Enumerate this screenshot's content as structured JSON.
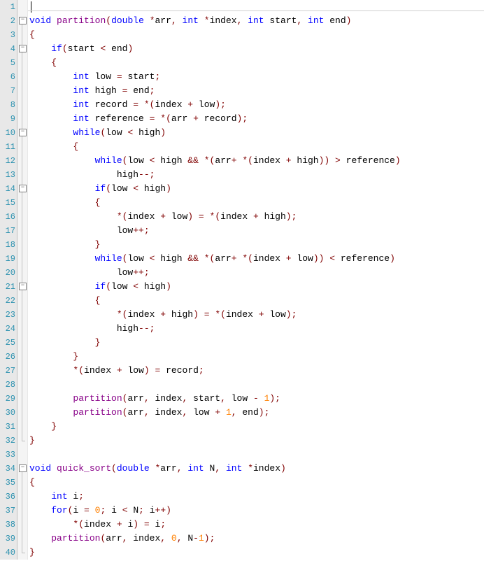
{
  "line_count": 40,
  "fold_boxes": [
    {
      "line": 2
    },
    {
      "line": 4
    },
    {
      "line": 10
    },
    {
      "line": 14
    },
    {
      "line": 21
    },
    {
      "line": 34
    }
  ],
  "fold_ends": [
    {
      "line": 32
    },
    {
      "line": 40
    }
  ],
  "code_lines": [
    [],
    [
      [
        "kw",
        "void"
      ],
      [
        "plain",
        " "
      ],
      [
        "fn",
        "partition"
      ],
      [
        "op",
        "("
      ],
      [
        "kw",
        "double"
      ],
      [
        "plain",
        " "
      ],
      [
        "op",
        "*"
      ],
      [
        "plain",
        "arr"
      ],
      [
        "op",
        ","
      ],
      [
        "plain",
        " "
      ],
      [
        "kw",
        "int"
      ],
      [
        "plain",
        " "
      ],
      [
        "op",
        "*"
      ],
      [
        "plain",
        "index"
      ],
      [
        "op",
        ","
      ],
      [
        "plain",
        " "
      ],
      [
        "kw",
        "int"
      ],
      [
        "plain",
        " start"
      ],
      [
        "op",
        ","
      ],
      [
        "plain",
        " "
      ],
      [
        "kw",
        "int"
      ],
      [
        "plain",
        " end"
      ],
      [
        "op",
        ")"
      ]
    ],
    [
      [
        "op",
        "{"
      ]
    ],
    [
      [
        "plain",
        "    "
      ],
      [
        "kw",
        "if"
      ],
      [
        "op",
        "("
      ],
      [
        "plain",
        "start "
      ],
      [
        "op",
        "<"
      ],
      [
        "plain",
        " end"
      ],
      [
        "op",
        ")"
      ]
    ],
    [
      [
        "plain",
        "    "
      ],
      [
        "op",
        "{"
      ]
    ],
    [
      [
        "plain",
        "        "
      ],
      [
        "kw",
        "int"
      ],
      [
        "plain",
        " low "
      ],
      [
        "op",
        "="
      ],
      [
        "plain",
        " start"
      ],
      [
        "op",
        ";"
      ]
    ],
    [
      [
        "plain",
        "        "
      ],
      [
        "kw",
        "int"
      ],
      [
        "plain",
        " high "
      ],
      [
        "op",
        "="
      ],
      [
        "plain",
        " end"
      ],
      [
        "op",
        ";"
      ]
    ],
    [
      [
        "plain",
        "        "
      ],
      [
        "kw",
        "int"
      ],
      [
        "plain",
        " record "
      ],
      [
        "op",
        "="
      ],
      [
        "plain",
        " "
      ],
      [
        "op",
        "*("
      ],
      [
        "plain",
        "index "
      ],
      [
        "op",
        "+"
      ],
      [
        "plain",
        " low"
      ],
      [
        "op",
        ");"
      ]
    ],
    [
      [
        "plain",
        "        "
      ],
      [
        "kw",
        "int"
      ],
      [
        "plain",
        " reference "
      ],
      [
        "op",
        "="
      ],
      [
        "plain",
        " "
      ],
      [
        "op",
        "*("
      ],
      [
        "plain",
        "arr "
      ],
      [
        "op",
        "+"
      ],
      [
        "plain",
        " record"
      ],
      [
        "op",
        ");"
      ]
    ],
    [
      [
        "plain",
        "        "
      ],
      [
        "kw",
        "while"
      ],
      [
        "op",
        "("
      ],
      [
        "plain",
        "low "
      ],
      [
        "op",
        "<"
      ],
      [
        "plain",
        " high"
      ],
      [
        "op",
        ")"
      ]
    ],
    [
      [
        "plain",
        "        "
      ],
      [
        "op",
        "{"
      ]
    ],
    [
      [
        "plain",
        "            "
      ],
      [
        "kw",
        "while"
      ],
      [
        "op",
        "("
      ],
      [
        "plain",
        "low "
      ],
      [
        "op",
        "<"
      ],
      [
        "plain",
        " high "
      ],
      [
        "op",
        "&&"
      ],
      [
        "plain",
        " "
      ],
      [
        "op",
        "*("
      ],
      [
        "plain",
        "arr"
      ],
      [
        "op",
        "+"
      ],
      [
        "plain",
        " "
      ],
      [
        "op",
        "*("
      ],
      [
        "plain",
        "index "
      ],
      [
        "op",
        "+"
      ],
      [
        "plain",
        " high"
      ],
      [
        "op",
        "))"
      ],
      [
        "plain",
        " "
      ],
      [
        "op",
        ">"
      ],
      [
        "plain",
        " reference"
      ],
      [
        "op",
        ")"
      ]
    ],
    [
      [
        "plain",
        "                high"
      ],
      [
        "op",
        "--;"
      ]
    ],
    [
      [
        "plain",
        "            "
      ],
      [
        "kw",
        "if"
      ],
      [
        "op",
        "("
      ],
      [
        "plain",
        "low "
      ],
      [
        "op",
        "<"
      ],
      [
        "plain",
        " high"
      ],
      [
        "op",
        ")"
      ]
    ],
    [
      [
        "plain",
        "            "
      ],
      [
        "op",
        "{"
      ]
    ],
    [
      [
        "plain",
        "                "
      ],
      [
        "op",
        "*("
      ],
      [
        "plain",
        "index "
      ],
      [
        "op",
        "+"
      ],
      [
        "plain",
        " low"
      ],
      [
        "op",
        ")"
      ],
      [
        "plain",
        " "
      ],
      [
        "op",
        "="
      ],
      [
        "plain",
        " "
      ],
      [
        "op",
        "*("
      ],
      [
        "plain",
        "index "
      ],
      [
        "op",
        "+"
      ],
      [
        "plain",
        " high"
      ],
      [
        "op",
        ");"
      ]
    ],
    [
      [
        "plain",
        "                low"
      ],
      [
        "op",
        "++;"
      ]
    ],
    [
      [
        "plain",
        "            "
      ],
      [
        "op",
        "}"
      ]
    ],
    [
      [
        "plain",
        "            "
      ],
      [
        "kw",
        "while"
      ],
      [
        "op",
        "("
      ],
      [
        "plain",
        "low "
      ],
      [
        "op",
        "<"
      ],
      [
        "plain",
        " high "
      ],
      [
        "op",
        "&&"
      ],
      [
        "plain",
        " "
      ],
      [
        "op",
        "*("
      ],
      [
        "plain",
        "arr"
      ],
      [
        "op",
        "+"
      ],
      [
        "plain",
        " "
      ],
      [
        "op",
        "*("
      ],
      [
        "plain",
        "index "
      ],
      [
        "op",
        "+"
      ],
      [
        "plain",
        " low"
      ],
      [
        "op",
        "))"
      ],
      [
        "plain",
        " "
      ],
      [
        "op",
        "<"
      ],
      [
        "plain",
        " reference"
      ],
      [
        "op",
        ")"
      ]
    ],
    [
      [
        "plain",
        "                low"
      ],
      [
        "op",
        "++;"
      ]
    ],
    [
      [
        "plain",
        "            "
      ],
      [
        "kw",
        "if"
      ],
      [
        "op",
        "("
      ],
      [
        "plain",
        "low "
      ],
      [
        "op",
        "<"
      ],
      [
        "plain",
        " high"
      ],
      [
        "op",
        ")"
      ]
    ],
    [
      [
        "plain",
        "            "
      ],
      [
        "op",
        "{"
      ]
    ],
    [
      [
        "plain",
        "                "
      ],
      [
        "op",
        "*("
      ],
      [
        "plain",
        "index "
      ],
      [
        "op",
        "+"
      ],
      [
        "plain",
        " high"
      ],
      [
        "op",
        ")"
      ],
      [
        "plain",
        " "
      ],
      [
        "op",
        "="
      ],
      [
        "plain",
        " "
      ],
      [
        "op",
        "*("
      ],
      [
        "plain",
        "index "
      ],
      [
        "op",
        "+"
      ],
      [
        "plain",
        " low"
      ],
      [
        "op",
        ");"
      ]
    ],
    [
      [
        "plain",
        "                high"
      ],
      [
        "op",
        "--;"
      ]
    ],
    [
      [
        "plain",
        "            "
      ],
      [
        "op",
        "}"
      ]
    ],
    [
      [
        "plain",
        "        "
      ],
      [
        "op",
        "}"
      ]
    ],
    [
      [
        "plain",
        "        "
      ],
      [
        "op",
        "*("
      ],
      [
        "plain",
        "index "
      ],
      [
        "op",
        "+"
      ],
      [
        "plain",
        " low"
      ],
      [
        "op",
        ")"
      ],
      [
        "plain",
        " "
      ],
      [
        "op",
        "="
      ],
      [
        "plain",
        " record"
      ],
      [
        "op",
        ";"
      ]
    ],
    [],
    [
      [
        "plain",
        "        "
      ],
      [
        "fn",
        "partition"
      ],
      [
        "op",
        "("
      ],
      [
        "plain",
        "arr"
      ],
      [
        "op",
        ","
      ],
      [
        "plain",
        " index"
      ],
      [
        "op",
        ","
      ],
      [
        "plain",
        " start"
      ],
      [
        "op",
        ","
      ],
      [
        "plain",
        " low "
      ],
      [
        "op",
        "-"
      ],
      [
        "plain",
        " "
      ],
      [
        "num",
        "1"
      ],
      [
        "op",
        ");"
      ]
    ],
    [
      [
        "plain",
        "        "
      ],
      [
        "fn",
        "partition"
      ],
      [
        "op",
        "("
      ],
      [
        "plain",
        "arr"
      ],
      [
        "op",
        ","
      ],
      [
        "plain",
        " index"
      ],
      [
        "op",
        ","
      ],
      [
        "plain",
        " low "
      ],
      [
        "op",
        "+"
      ],
      [
        "plain",
        " "
      ],
      [
        "num",
        "1"
      ],
      [
        "op",
        ","
      ],
      [
        "plain",
        " end"
      ],
      [
        "op",
        ");"
      ]
    ],
    [
      [
        "plain",
        "    "
      ],
      [
        "op",
        "}"
      ]
    ],
    [
      [
        "op",
        "}"
      ]
    ],
    [],
    [
      [
        "kw",
        "void"
      ],
      [
        "plain",
        " "
      ],
      [
        "fn",
        "quick_sort"
      ],
      [
        "op",
        "("
      ],
      [
        "kw",
        "double"
      ],
      [
        "plain",
        " "
      ],
      [
        "op",
        "*"
      ],
      [
        "plain",
        "arr"
      ],
      [
        "op",
        ","
      ],
      [
        "plain",
        " "
      ],
      [
        "kw",
        "int"
      ],
      [
        "plain",
        " N"
      ],
      [
        "op",
        ","
      ],
      [
        "plain",
        " "
      ],
      [
        "kw",
        "int"
      ],
      [
        "plain",
        " "
      ],
      [
        "op",
        "*"
      ],
      [
        "plain",
        "index"
      ],
      [
        "op",
        ")"
      ]
    ],
    [
      [
        "op",
        "{"
      ]
    ],
    [
      [
        "plain",
        "    "
      ],
      [
        "kw",
        "int"
      ],
      [
        "plain",
        " i"
      ],
      [
        "op",
        ";"
      ]
    ],
    [
      [
        "plain",
        "    "
      ],
      [
        "kw",
        "for"
      ],
      [
        "op",
        "("
      ],
      [
        "plain",
        "i "
      ],
      [
        "op",
        "="
      ],
      [
        "plain",
        " "
      ],
      [
        "num",
        "0"
      ],
      [
        "op",
        ";"
      ],
      [
        "plain",
        " i "
      ],
      [
        "op",
        "<"
      ],
      [
        "plain",
        " N"
      ],
      [
        "op",
        ";"
      ],
      [
        "plain",
        " i"
      ],
      [
        "op",
        "++)"
      ]
    ],
    [
      [
        "plain",
        "        "
      ],
      [
        "op",
        "*("
      ],
      [
        "plain",
        "index "
      ],
      [
        "op",
        "+"
      ],
      [
        "plain",
        " i"
      ],
      [
        "op",
        ")"
      ],
      [
        "plain",
        " "
      ],
      [
        "op",
        "="
      ],
      [
        "plain",
        " i"
      ],
      [
        "op",
        ";"
      ]
    ],
    [
      [
        "plain",
        "    "
      ],
      [
        "fn",
        "partition"
      ],
      [
        "op",
        "("
      ],
      [
        "plain",
        "arr"
      ],
      [
        "op",
        ","
      ],
      [
        "plain",
        " index"
      ],
      [
        "op",
        ","
      ],
      [
        "plain",
        " "
      ],
      [
        "num",
        "0"
      ],
      [
        "op",
        ","
      ],
      [
        "plain",
        " N"
      ],
      [
        "op",
        "-"
      ],
      [
        "num",
        "1"
      ],
      [
        "op",
        ");"
      ]
    ],
    [
      [
        "op",
        "}"
      ]
    ]
  ]
}
